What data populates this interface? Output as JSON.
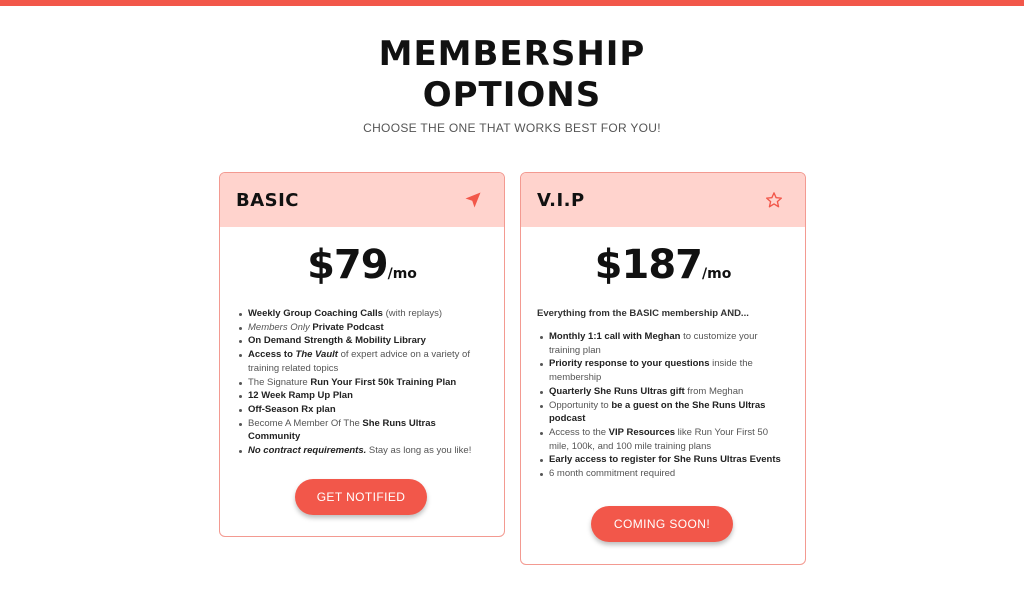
{
  "colors": {
    "accent": "#f2574a",
    "header_bg": "#ffd3cd",
    "border": "#f39a91"
  },
  "header": {
    "title_line1": "MEMBERSHIP",
    "title_line2": "OPTIONS",
    "subtitle": "CHOOSE THE ONE THAT WORKS BEST FOR YOU!"
  },
  "plans": [
    {
      "name": "BASIC",
      "icon": "navigation-arrow-icon",
      "price": "$79",
      "period": "/mo",
      "features": [
        {
          "a": "Weekly Group Coaching Calls",
          "b": " (with replays)"
        },
        {
          "a": "Members Only",
          "b": " Private Podcast"
        },
        {
          "a": "On Demand Strength & Mobility Library"
        },
        {
          "a": "Access to ",
          "b": "The Vault",
          "c": " of expert advice on a variety of training related topics"
        },
        {
          "a": "The Signature ",
          "b": "Run Your First 50k Training Plan"
        },
        {
          "a": "12 Week Ramp Up Plan"
        },
        {
          "a": "Off-Season Rx plan"
        },
        {
          "a": "Become A Member Of The ",
          "b": "She Runs Ultras Community"
        },
        {
          "a": "No contract requirements.",
          "b": " Stay as long as you like!"
        }
      ],
      "button": "GET NOTIFIED"
    },
    {
      "name": "V.I.P",
      "icon": "star-icon",
      "price": "$187",
      "period": "/mo",
      "intro": "Everything from the BASIC membership AND...",
      "features": [
        {
          "a": "Monthly 1:1 call with Meghan",
          "b": " to customize your training plan"
        },
        {
          "a": "Priority response to your questions",
          "b": " inside the membership"
        },
        {
          "a": "Quarterly She Runs Ultras gift",
          "b": " from Meghan"
        },
        {
          "a": "Opportunity to ",
          "b": "be a guest on the She Runs Ultras podcast"
        },
        {
          "a": "Access to the ",
          "b": "VIP Resources",
          "c": " like Run Your First 50 mile, 100k, and 100 mile training plans"
        },
        {
          "a": "Early access to register for She Runs Ultras Events"
        },
        {
          "a": "6 month commitment required"
        }
      ],
      "button": "COMING SOON!"
    }
  ]
}
